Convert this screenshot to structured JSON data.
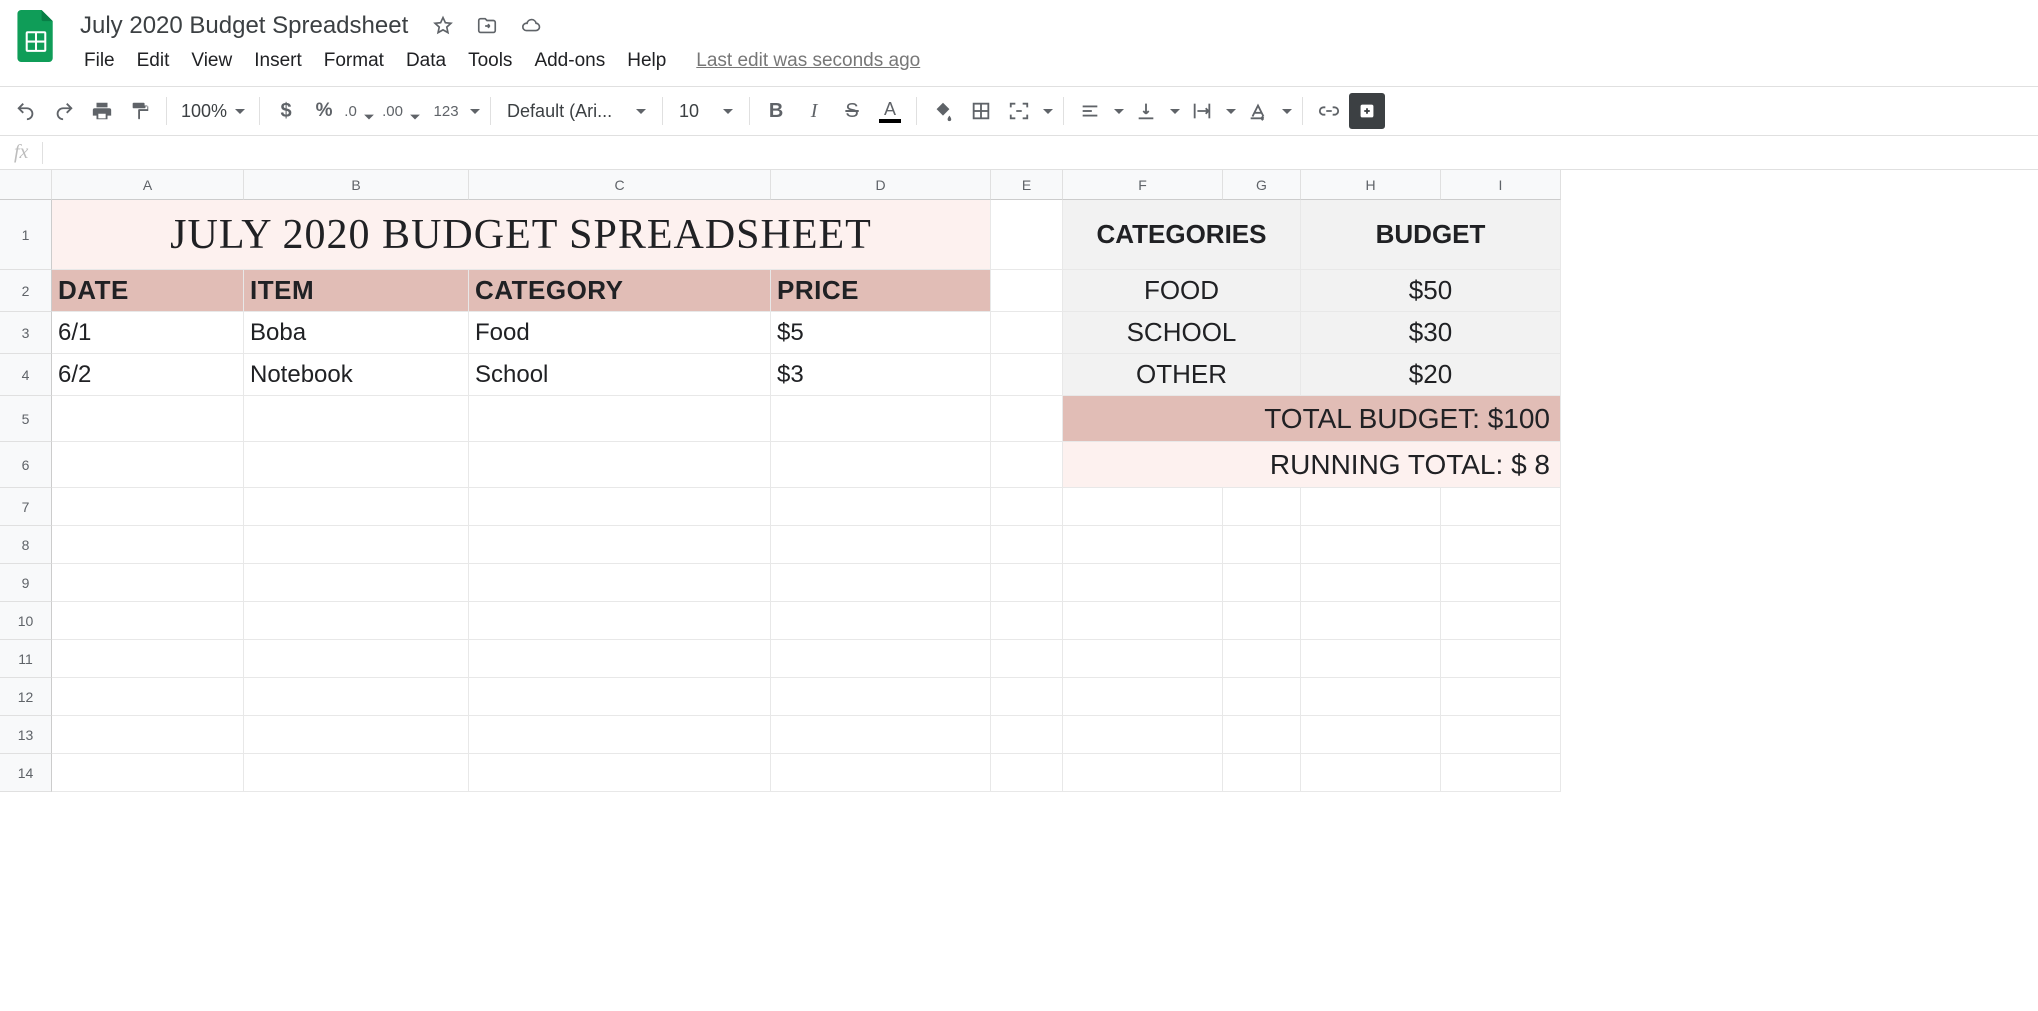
{
  "doc": {
    "name": "July 2020 Budget Spreadsheet"
  },
  "menu": {
    "file": "File",
    "edit": "Edit",
    "view": "View",
    "insert": "Insert",
    "format": "Format",
    "data": "Data",
    "tools": "Tools",
    "addons": "Add-ons",
    "help": "Help",
    "last_edit": "Last edit was seconds ago"
  },
  "toolbar": {
    "zoom": "100%",
    "font_family": "Default (Ari...",
    "font_size": "10",
    "format_123": "123"
  },
  "formula_bar": {
    "fx": "fx",
    "value": ""
  },
  "columns": [
    "A",
    "B",
    "C",
    "D",
    "E",
    "F",
    "G",
    "H",
    "I"
  ],
  "rowcount": 14,
  "sheet": {
    "title": "JULY 2020 BUDGET SPREADSHEET",
    "headers": {
      "date": "DATE",
      "item": "ITEM",
      "category": "CATEGORY",
      "price": "PRICE"
    },
    "entries": [
      {
        "date": "6/1",
        "item": "Boba",
        "category": "Food",
        "price": "$5"
      },
      {
        "date": "6/2",
        "item": "Notebook",
        "category": "School",
        "price": "$3"
      }
    ],
    "side": {
      "categories_hdr": "CATEGORIES",
      "budget_hdr": "BUDGET",
      "rows": [
        {
          "cat": "FOOD",
          "bud": "$50"
        },
        {
          "cat": "SCHOOL",
          "bud": "$30"
        },
        {
          "cat": "OTHER",
          "bud": "$20"
        }
      ],
      "total": "TOTAL BUDGET: $100",
      "running": "RUNNING TOTAL: $ 8"
    }
  }
}
